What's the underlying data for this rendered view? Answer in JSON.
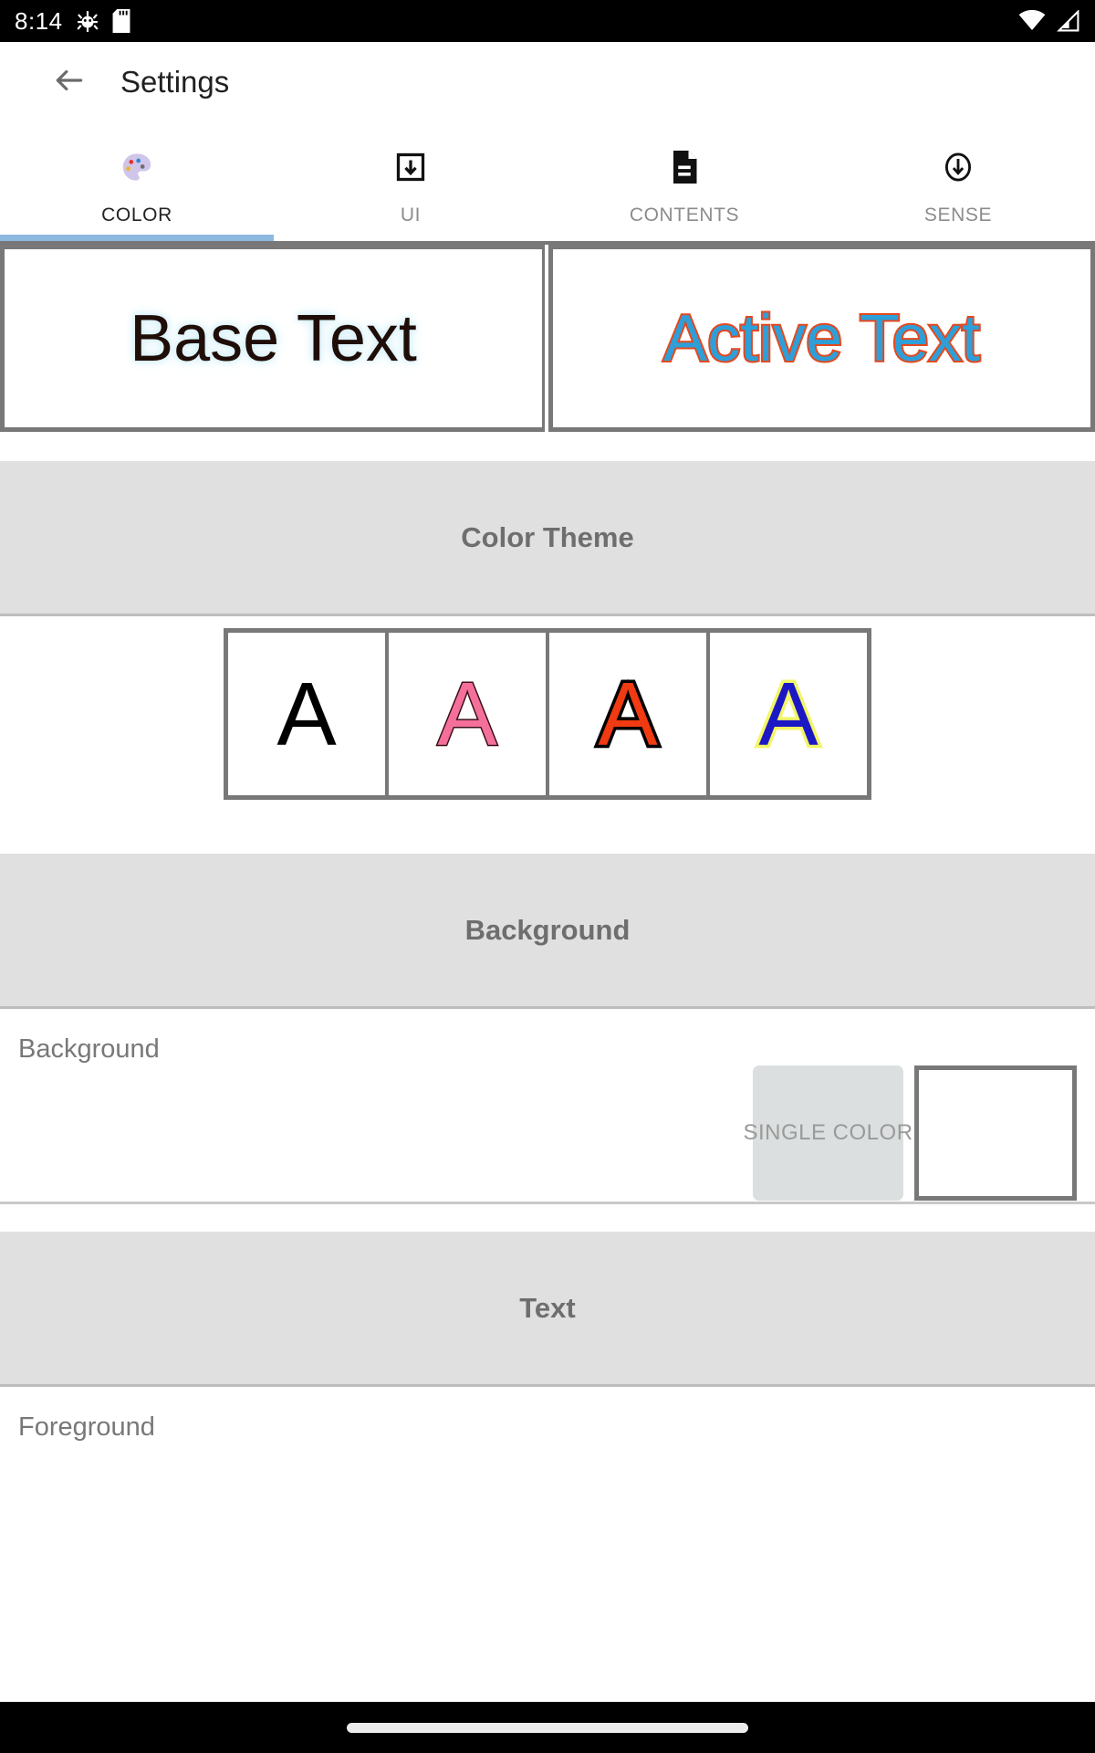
{
  "status_bar": {
    "time": "8:14",
    "left_icons": [
      "bug-icon",
      "sd-card-icon"
    ],
    "right_icons": [
      "wifi-icon",
      "signal-icon"
    ]
  },
  "app_bar": {
    "back_icon": "arrow-left-icon",
    "title": "Settings"
  },
  "tabs": {
    "active_index": 0,
    "items": [
      {
        "label": "COLOR",
        "icon": "palette-icon"
      },
      {
        "label": "UI",
        "icon": "download-box-icon"
      },
      {
        "label": "CONTENTS",
        "icon": "document-icon"
      },
      {
        "label": "SENSE",
        "icon": "circle-down-arrow-icon"
      }
    ]
  },
  "preview": {
    "base_text": "Base Text",
    "active_text": "Active Text",
    "base_color": "#1f0d08",
    "base_glow_color": "#d6f0f7",
    "active_fill_color": "#2e9fd8",
    "active_outline_color": "#e4491e"
  },
  "sections": {
    "color_theme": {
      "header": "Color Theme",
      "swatches": [
        {
          "letter": "A",
          "fill": "#000000",
          "outline": "none"
        },
        {
          "letter": "A",
          "fill": "#f4709a",
          "outline": "#3a1018"
        },
        {
          "letter": "A",
          "fill": "#f03a12",
          "outline": "#000000"
        },
        {
          "letter": "A",
          "fill": "#1c17c4",
          "outline": "#f2f566"
        }
      ]
    },
    "background": {
      "header": "Background",
      "row_title": "Background",
      "mode_button": "SINGLE COLOR",
      "swatch_color": "#ffffff"
    },
    "text": {
      "header": "Text",
      "row_title": "Foreground"
    }
  },
  "nav_bar": {
    "pill": "home-indicator"
  }
}
